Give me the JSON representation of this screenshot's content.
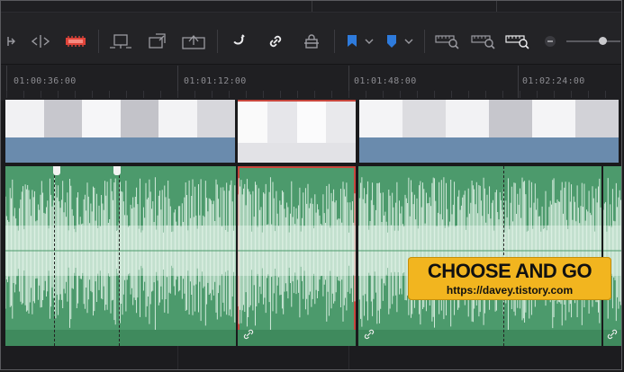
{
  "toolbar": {
    "tools": [
      {
        "name": "trim-edit-icon"
      },
      {
        "name": "dynamic-trim-icon"
      },
      {
        "name": "blade-icon"
      },
      {
        "name": "insert-clip-icon"
      },
      {
        "name": "overwrite-clip-icon"
      },
      {
        "name": "replace-clip-icon"
      },
      {
        "name": "snapping-icon"
      },
      {
        "name": "linked-selection-icon"
      },
      {
        "name": "position-lock-icon"
      },
      {
        "name": "flag-icon"
      },
      {
        "name": "marker-icon"
      },
      {
        "name": "zoom-full-icon"
      },
      {
        "name": "zoom-detail-icon"
      },
      {
        "name": "zoom-custom-icon"
      }
    ],
    "accent_colors": {
      "blade": "#e0443a",
      "flag": "#2e7bdc",
      "marker": "#2e7bdc"
    },
    "zoom_level": 0.6
  },
  "ruler": {
    "timecodes": [
      "01:00:36:00",
      "01:01:12:00",
      "01:01:48:00",
      "01:02:24:00"
    ]
  },
  "watermark": {
    "title": "CHOOSE AND GO",
    "url": "https://davey.tistory.com"
  },
  "colors": {
    "audio_clip": "#4c9a6c",
    "video_bar": "#6a8bad",
    "selection": "#c8473d"
  }
}
